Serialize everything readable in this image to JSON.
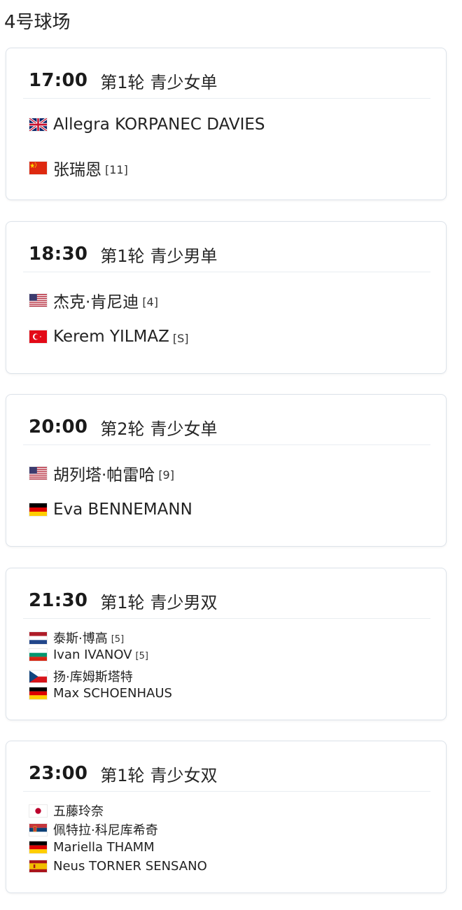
{
  "court": {
    "title": "4号球场"
  },
  "matches": [
    {
      "time": "17:00",
      "round": "第1轮",
      "event": "青少女单",
      "players": [
        {
          "flag_icon": "uk-flag-icon",
          "name": "Allegra KORPANEC DAVIES",
          "seed": ""
        },
        {
          "flag_icon": "china-flag-icon",
          "name": "张瑞恩",
          "seed": "[11]"
        }
      ]
    },
    {
      "time": "18:30",
      "round": "第1轮",
      "event": "青少男单",
      "players": [
        {
          "flag_icon": "usa-flag-icon",
          "name": "杰克·肯尼迪",
          "seed": "[4]"
        },
        {
          "flag_icon": "turkey-flag-icon",
          "name": "Kerem YILMAZ",
          "seed": "[S]"
        }
      ]
    },
    {
      "time": "20:00",
      "round": "第2轮",
      "event": "青少女单",
      "players": [
        {
          "flag_icon": "usa-flag-icon",
          "name": "胡列塔·帕雷哈",
          "seed": "[9]"
        },
        {
          "flag_icon": "germany-flag-icon",
          "name": "Eva BENNEMANN",
          "seed": ""
        }
      ]
    },
    {
      "time": "21:30",
      "round": "第1轮",
      "event": "青少男双",
      "players": [
        {
          "flag_icon": "netherlands-flag-icon",
          "name": "泰斯·博高",
          "seed": "[5]"
        },
        {
          "flag_icon": "bulgaria-flag-icon",
          "name": "Ivan IVANOV",
          "seed": "[5]"
        },
        {
          "flag_icon": "czech-flag-icon",
          "name": "扬·库姆斯塔特",
          "seed": ""
        },
        {
          "flag_icon": "germany-flag-icon",
          "name": "Max SCHOENHAUS",
          "seed": ""
        }
      ]
    },
    {
      "time": "23:00",
      "round": "第1轮",
      "event": "青少女双",
      "players": [
        {
          "flag_icon": "japan-flag-icon",
          "name": "五藤玲奈",
          "seed": ""
        },
        {
          "flag_icon": "serbia-flag-icon",
          "name": "佩特拉·科尼库希奇",
          "seed": ""
        },
        {
          "flag_icon": "germany-flag-icon",
          "name": "Mariella THAMM",
          "seed": ""
        },
        {
          "flag_icon": "spain-flag-icon",
          "name": "Neus TORNER SENSANO",
          "seed": ""
        }
      ]
    }
  ]
}
